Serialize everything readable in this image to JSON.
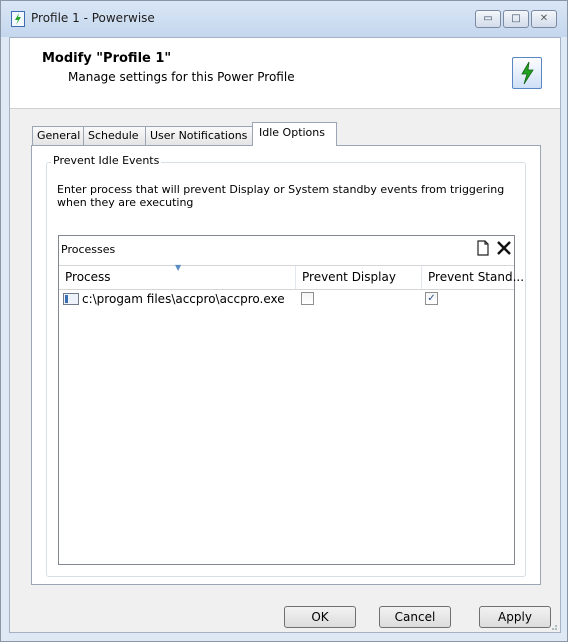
{
  "window": {
    "title": "Profile 1 - Powerwise",
    "minimize_glyph": "▭",
    "maximize_glyph": "□",
    "close_glyph": "✕"
  },
  "header": {
    "title": "Modify \"Profile 1\"",
    "subtitle": "Manage settings for this Power Profile",
    "icon": "power-profile-icon"
  },
  "tabs": [
    {
      "label": "General",
      "active": false
    },
    {
      "label": "Schedule",
      "active": false
    },
    {
      "label": "User Notifications",
      "active": false
    },
    {
      "label": "Idle Options",
      "active": true
    }
  ],
  "group": {
    "legend": "Prevent Idle Events",
    "description": "Enter process that will prevent Display or System standby events from triggering when they are executing"
  },
  "processes": {
    "title": "Processes",
    "new_icon": "new-document-icon",
    "delete_icon": "delete-x-icon",
    "columns": [
      "Process",
      "Prevent Display",
      "Prevent Stand..."
    ],
    "rows": [
      {
        "process": "c:\\progam files\\accpro\\accpro.exe",
        "prevent_display": false,
        "prevent_standby": true,
        "checked_glyph": "✓",
        "unchecked_glyph": ""
      }
    ]
  },
  "buttons": {
    "ok": "OK",
    "cancel": "Cancel",
    "apply": "Apply"
  }
}
